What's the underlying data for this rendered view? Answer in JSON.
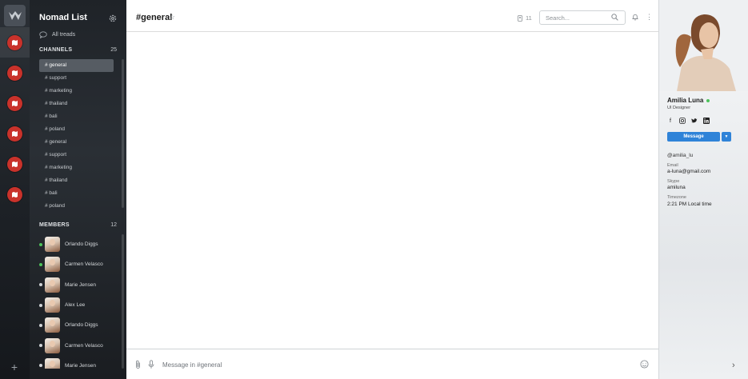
{
  "workspace_rail": {
    "items": [
      "map-pin-icon",
      "map-pin-icon",
      "map-pin-icon",
      "map-pin-icon",
      "map-pin-icon",
      "map-pin-icon"
    ],
    "add_label": "+"
  },
  "sidebar": {
    "team_name": "Nomad List",
    "threads_label": "All treads",
    "channels_header": "CHANNELS",
    "channels_count": "25",
    "channels": [
      "# general",
      "# support",
      "# marketing",
      "# thailand",
      "# bali",
      "# poland",
      "# general",
      "# support",
      "# marketing",
      "# thailand",
      "# bali",
      "# poland"
    ],
    "members_header": "MEMBERS",
    "members_count": "12",
    "members": [
      {
        "name": "Orlando Diggs",
        "online": true
      },
      {
        "name": "Carmen Velasco",
        "online": true
      },
      {
        "name": "Marie Jensen",
        "online": false
      },
      {
        "name": "Alex Lee",
        "online": false
      },
      {
        "name": "Orlando Diggs",
        "online": false
      },
      {
        "name": "Carmen Velasco",
        "online": false
      },
      {
        "name": "Marie Jensen",
        "online": false
      }
    ]
  },
  "header": {
    "channel_title": "#general",
    "member_count": "11",
    "search_placeholder": "Search..."
  },
  "composer": {
    "placeholder": "Message in #general"
  },
  "profile": {
    "name": "Amilia Luna",
    "role": "UI Designer",
    "message_button": "Message",
    "handle": "@amilia_lu",
    "email_label": "Email",
    "email": "a-luna@gmail.com",
    "skype_label": "Skype",
    "skype": "amiluna",
    "timezone_label": "Timezone",
    "timezone": "2:21 PM Local time"
  },
  "colors": {
    "accent": "#2f83d8",
    "online": "#4cc35a",
    "brand_red": "#c9322b"
  }
}
